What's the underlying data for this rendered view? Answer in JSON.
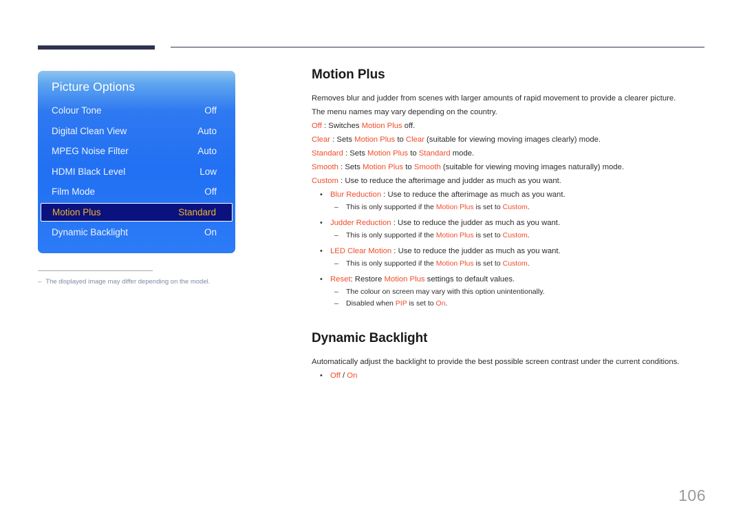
{
  "page": {
    "number": "106",
    "accent_orange": "#ef4d2a",
    "menu_blue": "#2170f3",
    "selected_navy": "#0b1280",
    "selected_gold": "#f0b429",
    "rule_navy": "#2e3350"
  },
  "osd": {
    "title": "Picture Options",
    "items": [
      {
        "label": "Colour Tone",
        "value": "Off",
        "selected": false
      },
      {
        "label": "Digital Clean View",
        "value": "Auto",
        "selected": false
      },
      {
        "label": "MPEG Noise Filter",
        "value": "Auto",
        "selected": false
      },
      {
        "label": "HDMI Black Level",
        "value": "Low",
        "selected": false
      },
      {
        "label": "Film Mode",
        "value": "Off",
        "selected": false
      },
      {
        "label": "Motion Plus",
        "value": "Standard",
        "selected": true
      },
      {
        "label": "Dynamic Backlight",
        "value": "On",
        "selected": false
      }
    ],
    "footnote": {
      "dash": "–",
      "text": "The displayed image may differ depending on the model."
    }
  },
  "sections": {
    "motion_plus": {
      "heading": "Motion Plus",
      "intro_1": "Removes blur and judder from scenes with larger amounts of rapid movement to provide a clearer picture.",
      "intro_2": "The menu names may vary depending on the country.",
      "modes": {
        "off": {
          "term": "Off",
          "mid": " : Switches ",
          "ref": "Motion Plus",
          "tail": " off."
        },
        "clear": {
          "term": "Clear",
          "mid": " : Sets ",
          "ref": "Motion Plus",
          "mid2": " to ",
          "value": "Clear",
          "tail": " (suitable for viewing moving images clearly) mode."
        },
        "standard": {
          "term": "Standard",
          "mid": " : Sets ",
          "ref": "Motion Plus",
          "mid2": " to ",
          "value": "Standard",
          "tail": " mode."
        },
        "smooth": {
          "term": "Smooth",
          "mid": " : Sets ",
          "ref": "Motion Plus",
          "mid2": " to ",
          "value": "Smooth",
          "tail": " (suitable for viewing moving images naturally) mode."
        },
        "custom": {
          "term": "Custom",
          "tail": " : Use to reduce the afterimage and judder as much as you want."
        }
      },
      "custom_items": [
        {
          "term": "Blur Reduction",
          "tail": " : Use to reduce the afterimage as much as you want.",
          "subs": [
            {
              "pre": "This is only supported if the ",
              "ref": "Motion Plus",
              "mid": " is set to ",
              "value": "Custom",
              "tail": "."
            }
          ]
        },
        {
          "term": "Judder Reduction",
          "tail": " : Use to reduce the judder as much as you want.",
          "subs": [
            {
              "pre": "This is only supported if the ",
              "ref": "Motion Plus",
              "mid": " is set to ",
              "value": "Custom",
              "tail": "."
            }
          ]
        },
        {
          "term": "LED Clear Motion",
          "tail": " : Use to reduce the judder as much as you want.",
          "subs": [
            {
              "pre": "This is only supported if the ",
              "ref": "Motion Plus",
              "mid": " is set to ",
              "value": "Custom",
              "tail": "."
            }
          ]
        },
        {
          "term": "Reset",
          "mid": ": Restore ",
          "ref": "Motion Plus",
          "tail": " settings to default values.",
          "subs": [
            {
              "pre": "The colour on screen may vary with this option unintentionally."
            },
            {
              "pre": "Disabled when ",
              "ref": "PIP",
              "mid": " is set to ",
              "value": "On",
              "tail": "."
            }
          ]
        }
      ]
    },
    "dynamic_backlight": {
      "heading": "Dynamic Backlight",
      "intro": "Automatically adjust the backlight to provide the best possible screen contrast under the current conditions.",
      "option_off": "Off",
      "option_sep": " / ",
      "option_on": "On"
    }
  }
}
